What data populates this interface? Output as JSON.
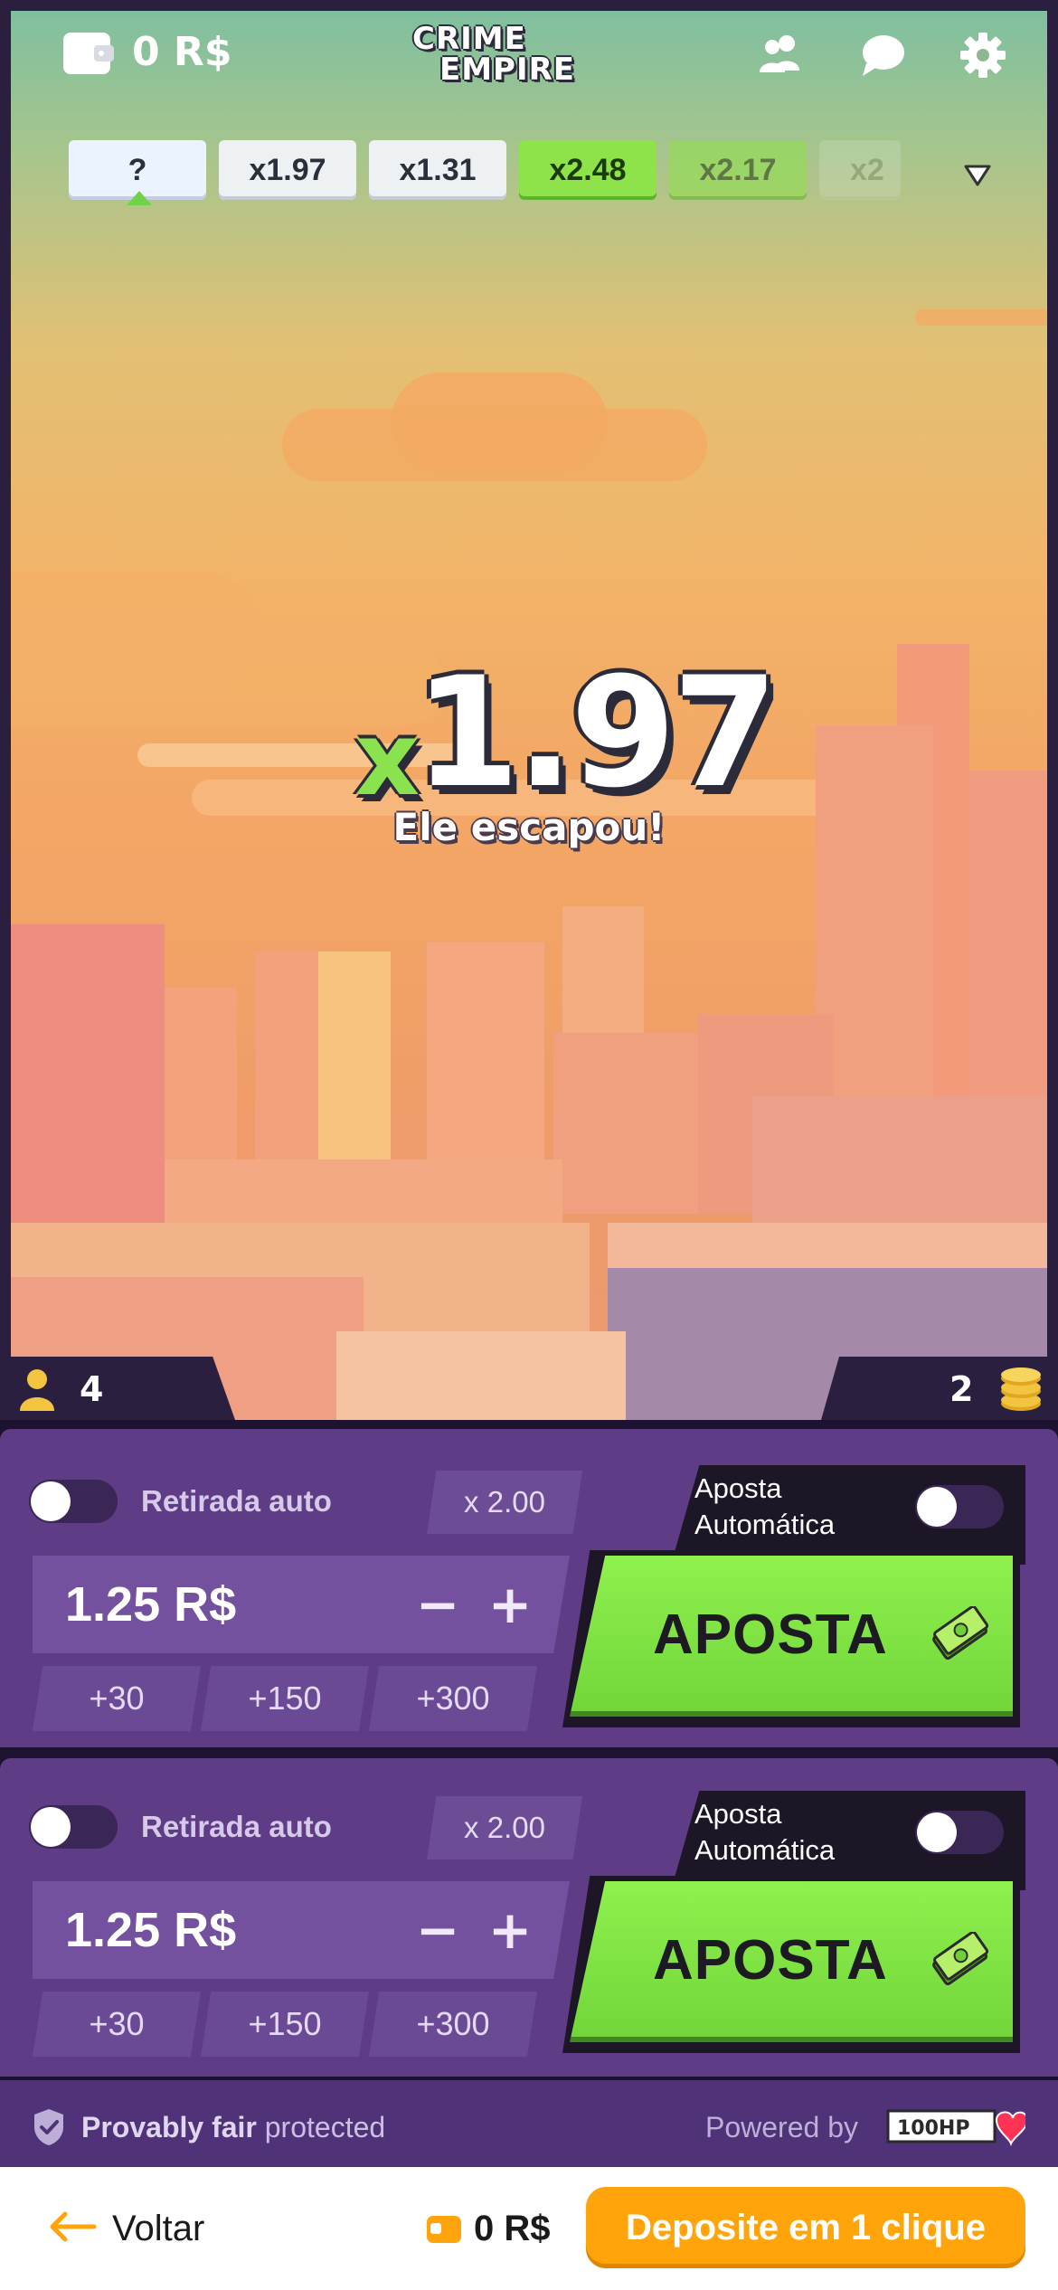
{
  "header": {
    "balance": "0 R$",
    "logo_line1": "CRIME",
    "logo_line2": "EMPIRE",
    "icons": [
      "wallet-icon",
      "users-icon",
      "chat-icon",
      "gear-icon"
    ]
  },
  "history": {
    "current": "?",
    "items": [
      {
        "label": "x1.97",
        "style": "grey"
      },
      {
        "label": "x1.31",
        "style": "grey"
      },
      {
        "label": "x2.48",
        "style": "green"
      },
      {
        "label": "x2.17",
        "style": "green-faded"
      },
      {
        "label": "x2",
        "style": "grey-faded"
      }
    ]
  },
  "round": {
    "multiplier_prefix": "x",
    "multiplier_value": "1.97",
    "status": "Ele escapou!"
  },
  "stats": {
    "players": "4",
    "coins": "2"
  },
  "bets": [
    {
      "auto_cashout_label": "Retirada auto",
      "auto_cashout_enabled": false,
      "auto_multiplier": "x 2.00",
      "amount": "1.25 R$",
      "minus": "−",
      "plus": "+",
      "quick": [
        "+30",
        "+150",
        "+300"
      ],
      "auto_bet_label": "Aposta Automática",
      "auto_bet_enabled": false,
      "bet_label": "APOSTA"
    },
    {
      "auto_cashout_label": "Retirada auto",
      "auto_cashout_enabled": false,
      "auto_multiplier": "x 2.00",
      "amount": "1.25 R$",
      "minus": "−",
      "plus": "+",
      "quick": [
        "+30",
        "+150",
        "+300"
      ],
      "auto_bet_label": "Aposta Automática",
      "auto_bet_enabled": false,
      "bet_label": "APOSTA"
    }
  ],
  "footer": {
    "fair_bold": "Provably fair",
    "fair_rest": " protected",
    "powered_by": "Powered by",
    "provider": "100HP"
  },
  "bottom": {
    "back_label": "Voltar",
    "balance": "0 R$",
    "deposit_label": "Deposite em 1 clique"
  },
  "colors": {
    "accent_green": "#8ee24a",
    "panel_purple": "#5e3c86",
    "deposit_orange": "#ffa40a"
  }
}
